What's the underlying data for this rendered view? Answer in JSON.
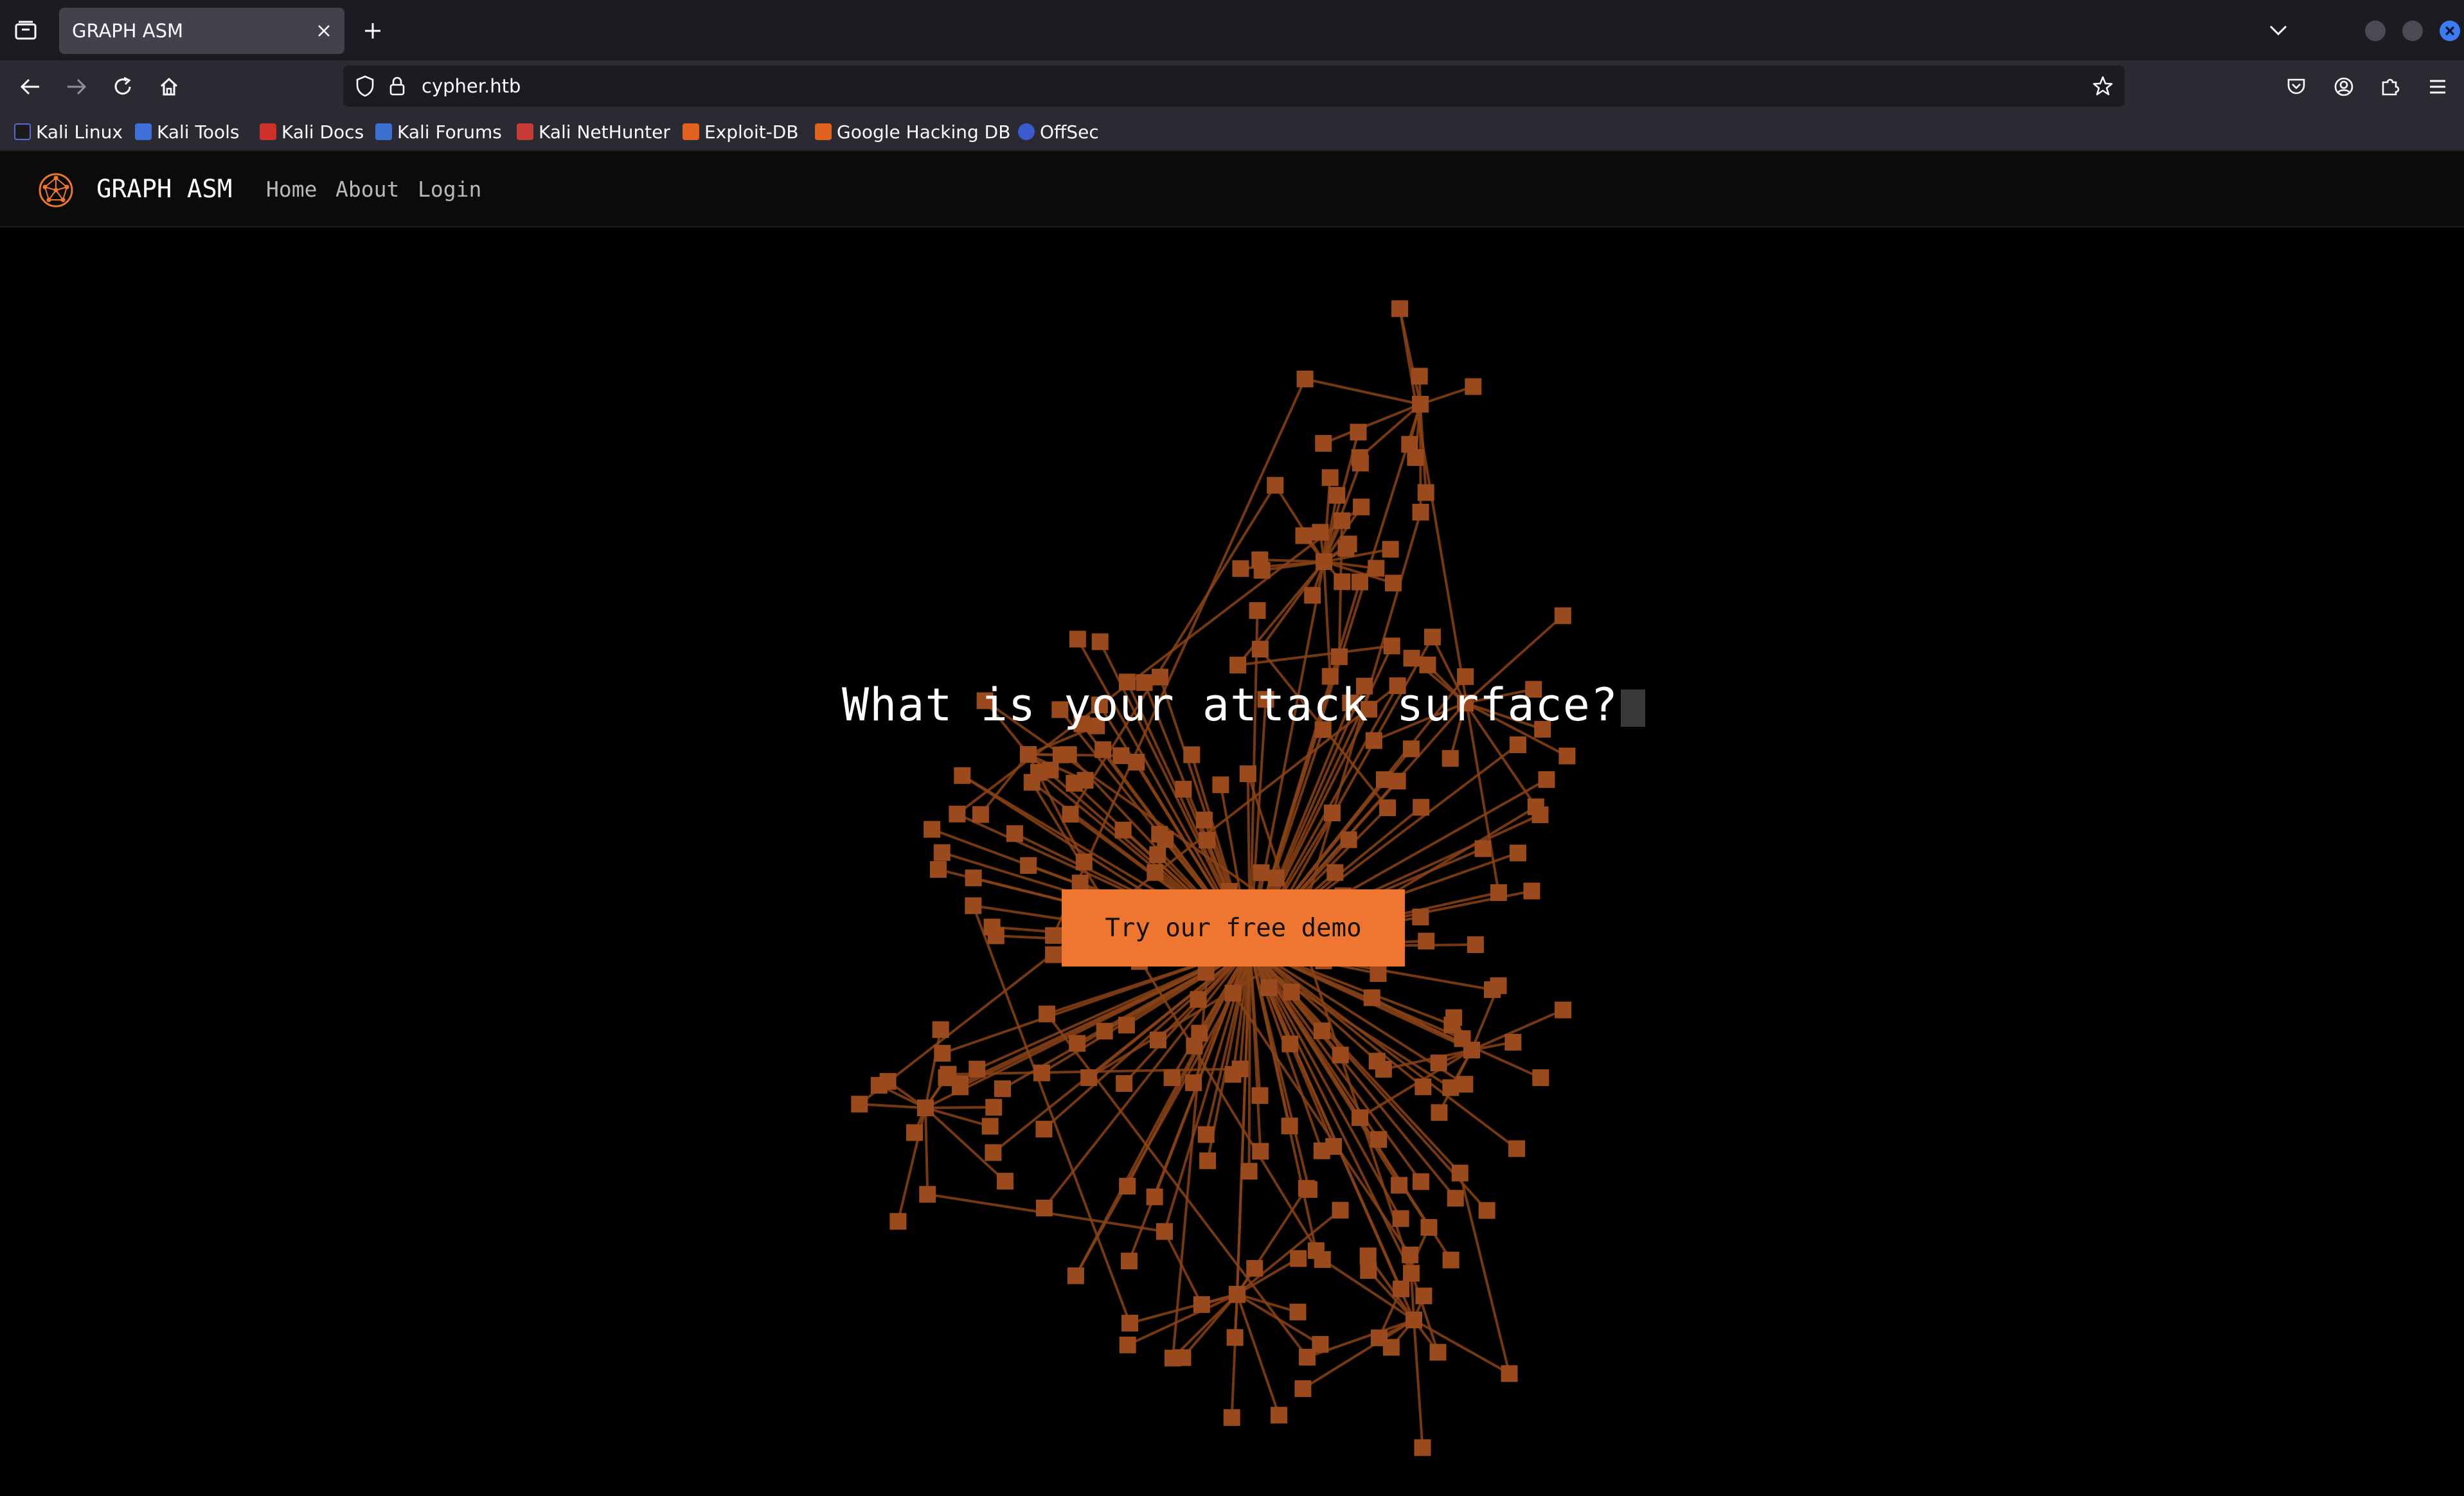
{
  "browser": {
    "tab": {
      "title": "GRAPH ASM"
    },
    "url": "cypher.htb",
    "bookmarks": [
      {
        "label": "Kali Linux",
        "icon": "kali-dragon-icon"
      },
      {
        "label": "Kali Tools",
        "icon": "kali-tools-icon"
      },
      {
        "label": "Kali Docs",
        "icon": "kali-docs-icon"
      },
      {
        "label": "Kali Forums",
        "icon": "kali-forums-icon"
      },
      {
        "label": "Kali NetHunter",
        "icon": "nethunter-icon"
      },
      {
        "label": "Exploit-DB",
        "icon": "exploitdb-icon"
      },
      {
        "label": "Google Hacking DB",
        "icon": "ghdb-icon"
      },
      {
        "label": "OffSec",
        "icon": "offsec-icon"
      }
    ]
  },
  "site": {
    "brand": "GRAPH ASM",
    "nav": [
      "Home",
      "About",
      "Login"
    ],
    "hero_title": "What is your attack surface?",
    "cta_label": "Try our free demo"
  },
  "colors": {
    "accent": "#ef7630",
    "graph_node": "#9a4a1c",
    "graph_edge": "#8a4216",
    "page_bg": "#000000"
  }
}
